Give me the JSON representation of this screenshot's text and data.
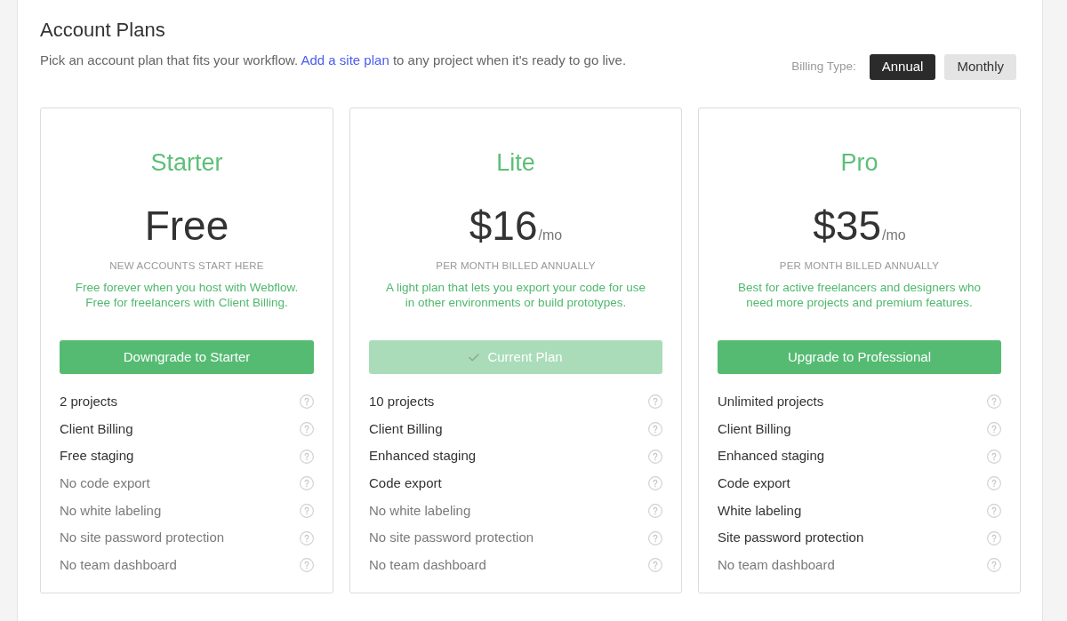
{
  "header": {
    "title": "Account Plans",
    "intro": {
      "before": "Pick an account plan that fits your workflow.",
      "link": "Add a site plan",
      "after": "to any project when it's ready to go live."
    }
  },
  "billing": {
    "label": "Billing Type:",
    "options": [
      {
        "label": "Annual",
        "selected": true
      },
      {
        "label": "Monthly",
        "selected": false
      }
    ]
  },
  "plans": [
    {
      "name": "Starter",
      "price": "Free",
      "note": "NEW ACCOUNTS START HERE",
      "description": "Free forever when you host with Webflow.\nFree for freelancers with Client Billing.",
      "button": {
        "label": "Downgrade to Starter",
        "current": false
      },
      "features": [
        {
          "label": "2 projects",
          "included": true
        },
        {
          "label": "Client Billing",
          "included": true
        },
        {
          "label": "Free staging",
          "included": true
        },
        {
          "label": "No code export",
          "included": false
        },
        {
          "label": "No white labeling",
          "included": false
        },
        {
          "label": "No site password protection",
          "included": false
        },
        {
          "label": "No team dashboard",
          "included": false
        }
      ]
    },
    {
      "name": "Lite",
      "price": "$16",
      "period": "/mo",
      "note": "PER MONTH BILLED ANNUALLY",
      "description": "A light plan that lets you export your code for use\nin other environments or build prototypes.",
      "button": {
        "label": "Current Plan",
        "current": true
      },
      "features": [
        {
          "label": "10 projects",
          "included": true
        },
        {
          "label": "Client Billing",
          "included": true
        },
        {
          "label": "Enhanced staging",
          "included": true
        },
        {
          "label": "Code export",
          "included": true
        },
        {
          "label": "No white labeling",
          "included": false
        },
        {
          "label": "No site password protection",
          "included": false
        },
        {
          "label": "No team dashboard",
          "included": false
        }
      ]
    },
    {
      "name": "Pro",
      "price": "$35",
      "period": "/mo",
      "note": "PER MONTH BILLED ANNUALLY",
      "description": "Best for active freelancers and designers who\nneed more projects and premium features.",
      "button": {
        "label": "Upgrade to Professional",
        "current": false
      },
      "features": [
        {
          "label": "Unlimited projects",
          "included": true
        },
        {
          "label": "Client Billing",
          "included": true
        },
        {
          "label": "Enhanced staging",
          "included": true
        },
        {
          "label": "Code export",
          "included": true
        },
        {
          "label": "White labeling",
          "included": true
        },
        {
          "label": "Site password protection",
          "included": true
        },
        {
          "label": "No team dashboard",
          "included": false
        }
      ]
    }
  ]
}
